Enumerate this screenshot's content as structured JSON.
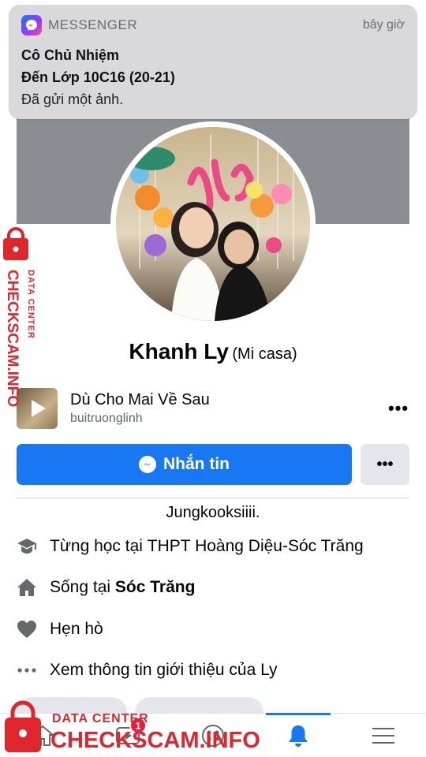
{
  "notification": {
    "app": "MESSENGER",
    "time": "bây giờ",
    "title_line1": "Cô Chủ Nhiệm",
    "title_line2": "Đến Lớp 10C16 (20-21)",
    "body": "Đã gửi một ảnh."
  },
  "profile": {
    "name": "Khanh Ly",
    "nickname": "(Mi casa)",
    "bio": "Jungkooksiiii."
  },
  "song": {
    "title": "Dù Cho Mai Về Sau",
    "artist": "buitruonglinh",
    "more": "•••"
  },
  "actions": {
    "message_label": "Nhắn tin",
    "more_label": "•••"
  },
  "info": {
    "education_prefix": "Từng học tại ",
    "education_place": "THPT Hoàng Diệu-Sóc Trăng",
    "lives_prefix": "Sống tại ",
    "lives_place": "Sóc Trăng",
    "dating": "Hẹn hò",
    "about": "Xem thông tin giới thiệu của Ly"
  },
  "tabbar": {
    "notification_badge": "1"
  },
  "watermark": {
    "line1": "DATA CENTER",
    "line2": "CHECKSCAM.INFO"
  },
  "colors": {
    "accent": "#1877f2",
    "badge": "#e41e3f",
    "watermark": "#e0262d"
  }
}
